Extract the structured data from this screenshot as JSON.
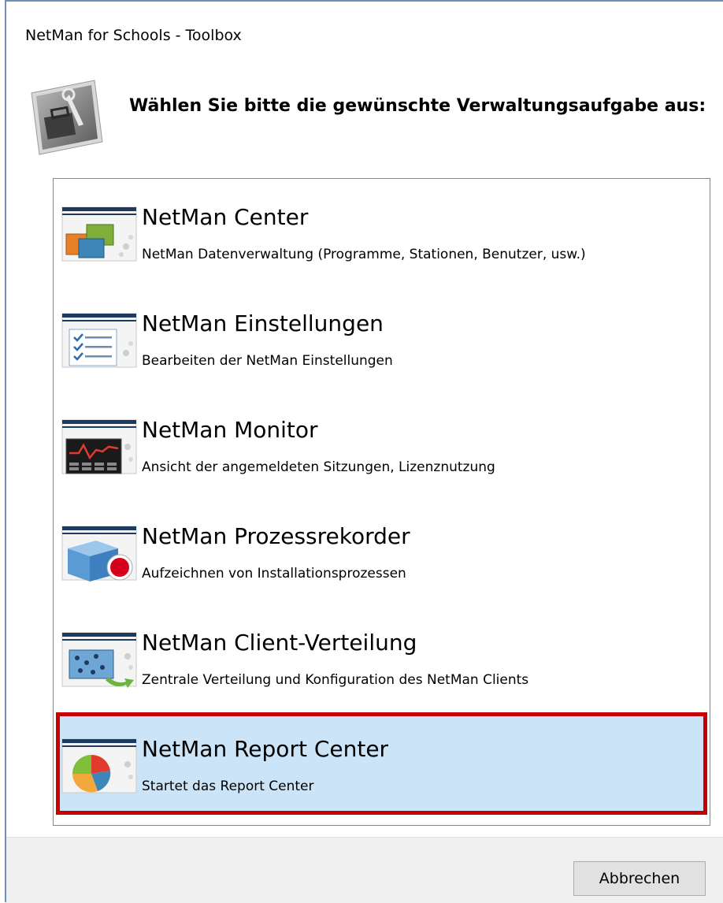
{
  "window": {
    "title": "NetMan for Schools - Toolbox"
  },
  "header": {
    "prompt": "Wählen Sie bitte die gewünschte Verwaltungsaufgabe aus:"
  },
  "items": [
    {
      "title": "NetMan Center",
      "description": "NetMan Datenverwaltung (Programme, Stationen, Benutzer, usw.)",
      "icon": "netman-center-icon"
    },
    {
      "title": "NetMan Einstellungen",
      "description": "Bearbeiten der NetMan Einstellungen",
      "icon": "settings-checklist-icon"
    },
    {
      "title": "NetMan Monitor",
      "description": "Ansicht der angemeldeten Sitzungen, Lizenznutzung",
      "icon": "monitor-graph-icon"
    },
    {
      "title": "NetMan Prozessrekorder",
      "description": "Aufzeichnen von Installationsprozessen",
      "icon": "process-recorder-icon"
    },
    {
      "title": "NetMan Client-Verteilung",
      "description": "Zentrale Verteilung und Konfiguration des NetMan Clients",
      "icon": "client-distribution-icon"
    },
    {
      "title": "NetMan Report Center",
      "description": "Startet das Report Center",
      "icon": "report-pie-chart-icon",
      "selected": true
    }
  ],
  "footer": {
    "cancel_label": "Abbrechen"
  },
  "colors": {
    "selection_bg": "#cce4f7",
    "highlight_border": "#c80000",
    "header_bar": "#1e3a5f"
  }
}
